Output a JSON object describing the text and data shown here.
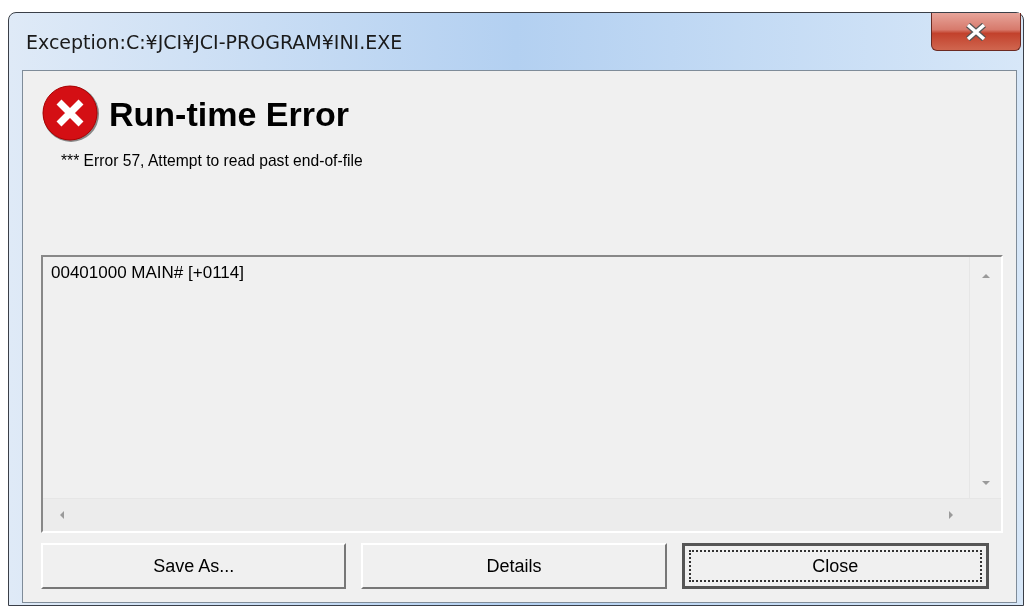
{
  "window": {
    "title": "Exception:C:¥JCI¥JCI-PROGRAM¥INI.EXE"
  },
  "heading": "Run-time Error",
  "message": "*** Error   57, Attempt to read past end-of-file",
  "trace": {
    "lines": [
      "00401000 MAIN# [+0114]"
    ]
  },
  "buttons": [
    {
      "label": "Save As...",
      "focused": false
    },
    {
      "label": "Details",
      "focused": false
    },
    {
      "label": "Close",
      "focused": true
    }
  ]
}
